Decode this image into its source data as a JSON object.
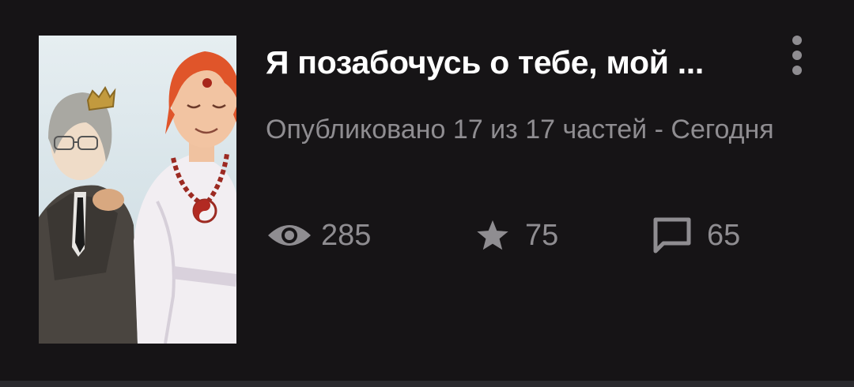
{
  "story": {
    "title": "Я позабочусь о тебе, мой ...",
    "published": "Опубликовано 17 из 17 частей - Сегодня",
    "cover_description": "illustration of two characters"
  },
  "stats": {
    "views": "285",
    "likes": "75",
    "comments": "65"
  },
  "icons": {
    "views": "eye-icon",
    "likes": "star-icon",
    "comments": "comment-icon",
    "more": "more-vertical-icon"
  },
  "colors": {
    "background": "#161416",
    "title": "#ffffff",
    "secondary": "#8f8d91"
  }
}
